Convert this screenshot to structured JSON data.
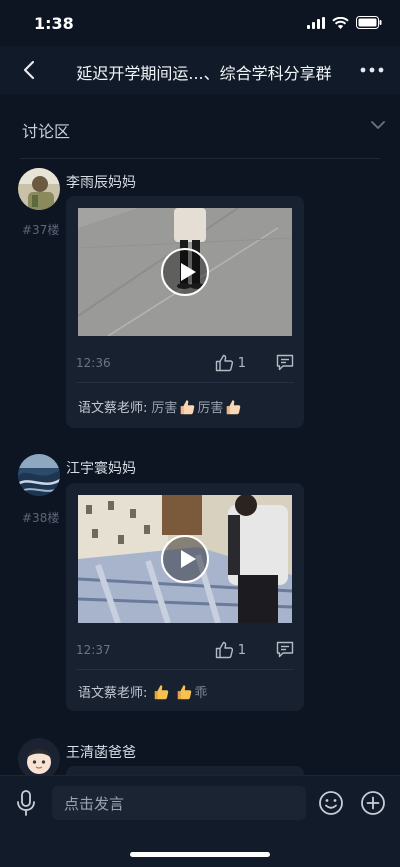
{
  "status_bar": {
    "time": "1:38"
  },
  "nav": {
    "title": "延迟开学期间运...、综合学科分享群"
  },
  "section": {
    "title": "讨论区"
  },
  "posts": [
    {
      "floor": "#37楼",
      "author": "李雨辰妈妈",
      "time": "12:36",
      "likes": "1",
      "reply": {
        "name": "语文蔡老师:",
        "parts": [
          "厉害",
          "厉害"
        ]
      }
    },
    {
      "floor": "#38楼",
      "author": "江宇寰妈妈",
      "time": "12:37",
      "likes": "1",
      "reply": {
        "name": "语文蔡老师:",
        "text_after": "乖"
      }
    },
    {
      "author": "王清菡爸爸"
    }
  ],
  "input": {
    "placeholder": "点击发言"
  },
  "colors": {
    "background": "#0d1522",
    "card": "#18212f",
    "navbar": "#111a28"
  }
}
